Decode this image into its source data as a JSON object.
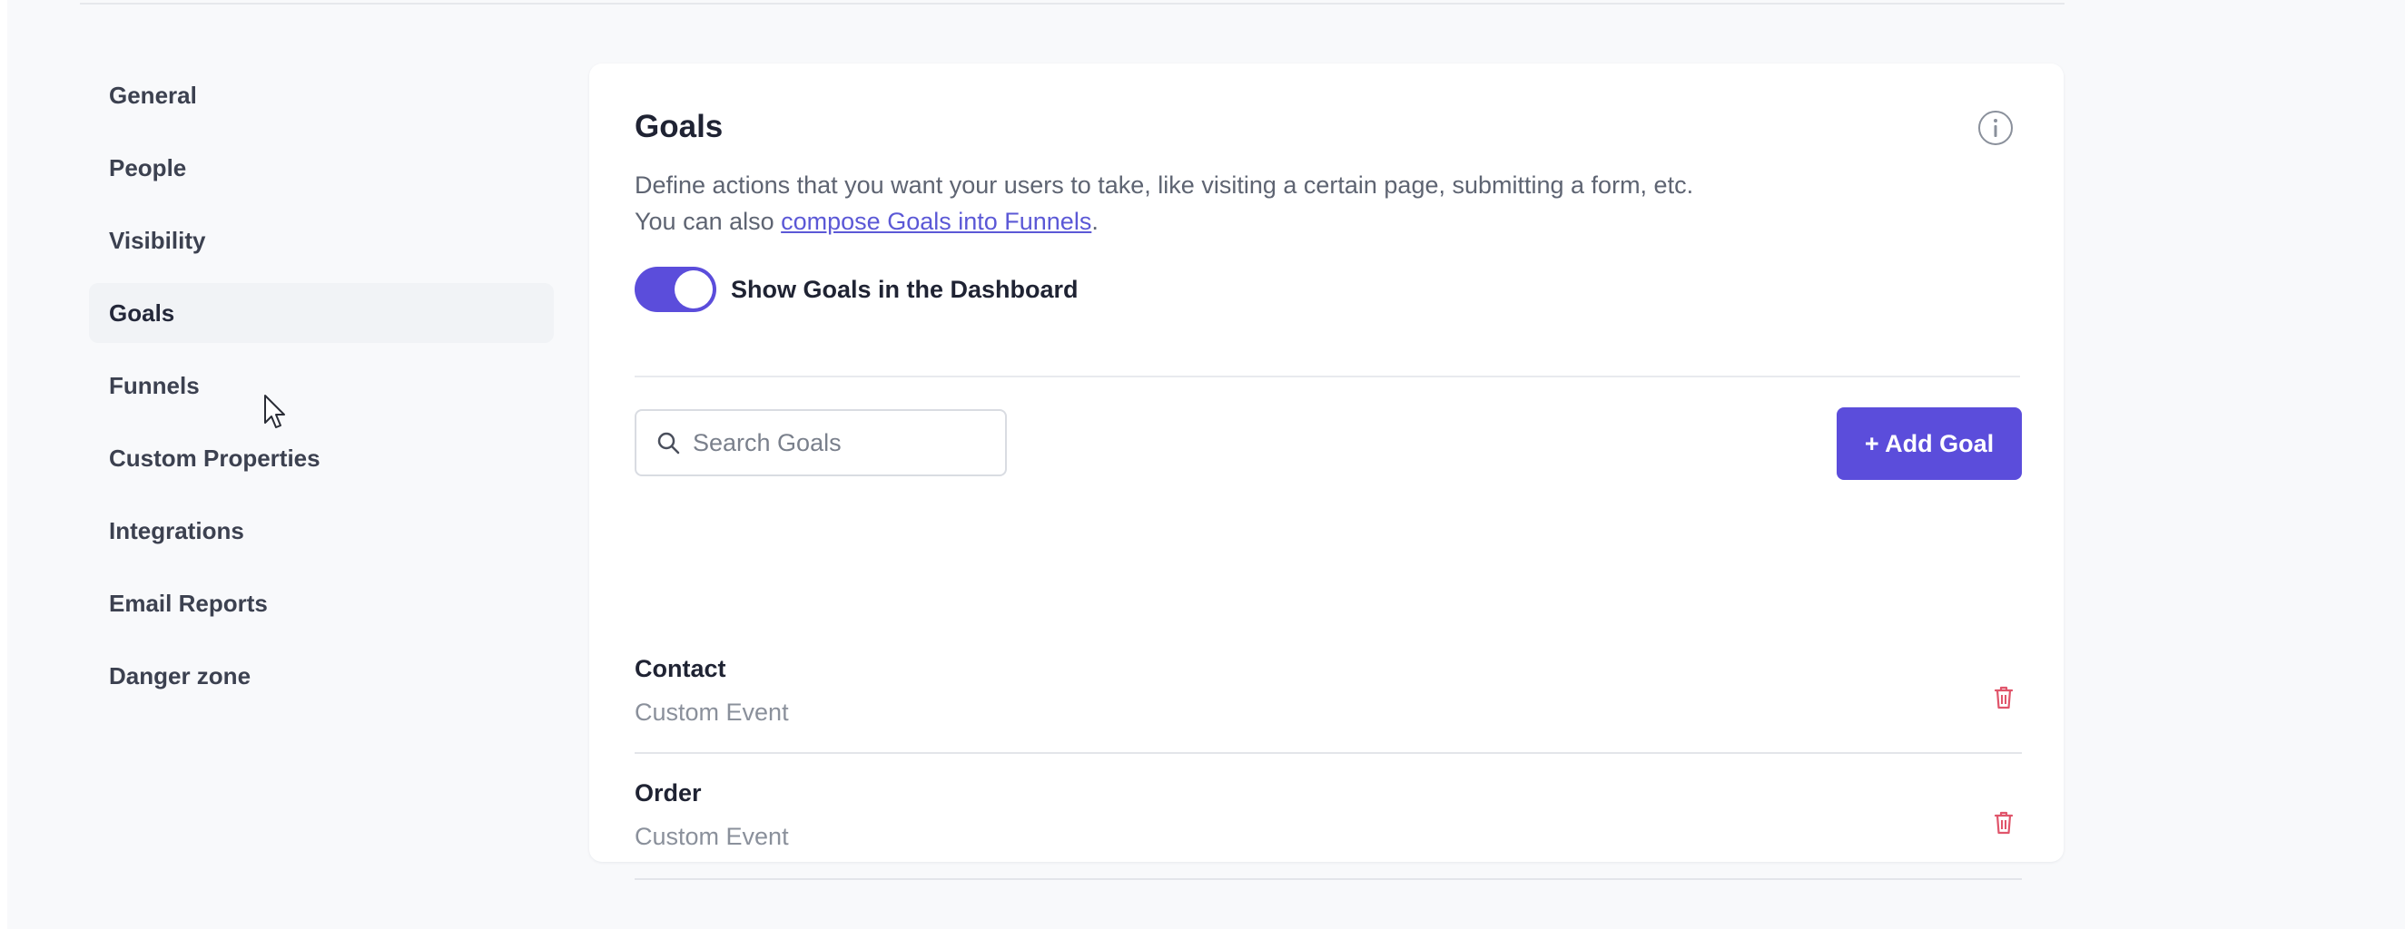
{
  "sidebar": {
    "items": [
      {
        "label": "General"
      },
      {
        "label": "People"
      },
      {
        "label": "Visibility"
      },
      {
        "label": "Goals"
      },
      {
        "label": "Funnels"
      },
      {
        "label": "Custom Properties"
      },
      {
        "label": "Integrations"
      },
      {
        "label": "Email Reports"
      },
      {
        "label": "Danger zone"
      }
    ],
    "active": "Goals"
  },
  "goals_panel": {
    "title": "Goals",
    "description_line1": "Define actions that you want your users to take, like visiting a certain page, submitting a form, etc.",
    "description_prefix": "You can also ",
    "description_link": "compose Goals into Funnels",
    "description_suffix": ".",
    "toggle_label": "Show Goals in the Dashboard",
    "toggle_on": true,
    "search": {
      "placeholder": "Search Goals",
      "value": ""
    },
    "add_button_label": "+ Add Goal",
    "goals": [
      {
        "name": "Contact",
        "type": "Custom Event"
      },
      {
        "name": "Order",
        "type": "Custom Event"
      }
    ]
  },
  "colors": {
    "accent": "#5b4ddb",
    "link": "#5b58d6",
    "delete": "#e0556b",
    "background": "#f8f9fb"
  },
  "icons": {
    "info": "info-circle-icon",
    "search": "search-icon",
    "delete": "trash-icon",
    "cursor": "mouse-pointer-icon"
  }
}
